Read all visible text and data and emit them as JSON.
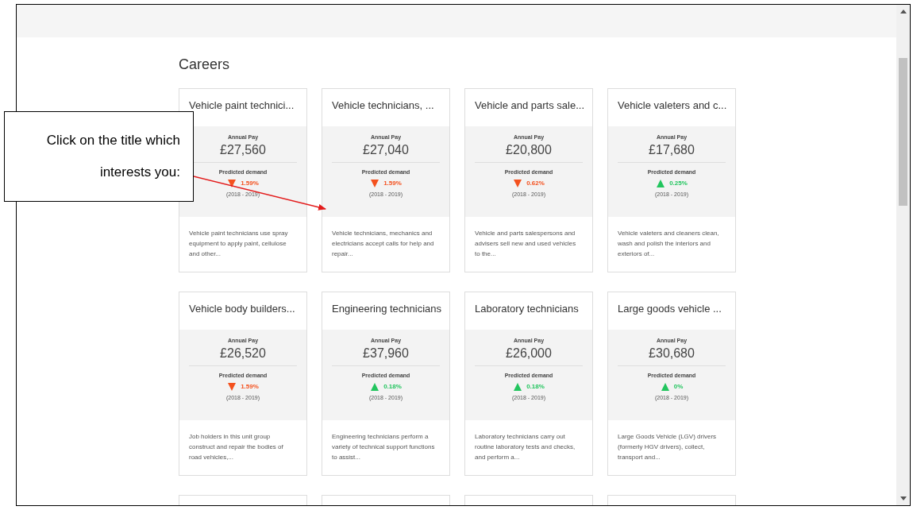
{
  "heading": "Careers",
  "cards": [
    {
      "title": "Vehicle paint technici...",
      "pay_label": "Annual Pay",
      "pay": "£27,560",
      "demand_label": "Predicted demand",
      "kind": "down",
      "change": "1.59%",
      "period": "(2018 - 2019)",
      "summary": "Vehicle paint technicians use spray equipment to apply paint, cellulose and other..."
    },
    {
      "title": "Vehicle technicians, ...",
      "pay_label": "Annual Pay",
      "pay": "£27,040",
      "demand_label": "Predicted demand",
      "kind": "down",
      "change": "1.59%",
      "period": "(2018 - 2019)",
      "summary": "Vehicle technicians, mechanics and electricians accept calls for help and repair..."
    },
    {
      "title": "Vehicle and parts sale...",
      "pay_label": "Annual Pay",
      "pay": "£20,800",
      "demand_label": "Predicted demand",
      "kind": "down",
      "change": "0.62%",
      "period": "(2018 - 2019)",
      "summary": "Vehicle and parts salespersons and advisers sell new and used vehicles to the..."
    },
    {
      "title": "Vehicle valeters and c...",
      "pay_label": "Annual Pay",
      "pay": "£17,680",
      "demand_label": "Predicted demand",
      "kind": "up",
      "change": "0.25%",
      "period": "(2018 - 2019)",
      "summary": "Vehicle valeters and cleaners clean, wash and polish the interiors and exteriors of..."
    },
    {
      "title": "Vehicle body builders...",
      "pay_label": "Annual Pay",
      "pay": "£26,520",
      "demand_label": "Predicted demand",
      "kind": "down",
      "change": "1.59%",
      "period": "(2018 - 2019)",
      "summary": "Job holders in this unit group construct and repair the bodies of road vehicles,..."
    },
    {
      "title": "Engineering technicians",
      "pay_label": "Annual Pay",
      "pay": "£37,960",
      "demand_label": "Predicted demand",
      "kind": "up",
      "change": "0.18%",
      "period": "(2018 - 2019)",
      "summary": "Engineering technicians perform a variety of technical support functions to assist..."
    },
    {
      "title": "Laboratory technicians",
      "pay_label": "Annual Pay",
      "pay": "£26,000",
      "demand_label": "Predicted demand",
      "kind": "up",
      "change": "0.18%",
      "period": "(2018 - 2019)",
      "summary": "Laboratory technicians carry out routine laboratory tests and checks, and perform a..."
    },
    {
      "title": "Large goods vehicle ...",
      "pay_label": "Annual Pay",
      "pay": "£30,680",
      "demand_label": "Predicted demand",
      "kind": "up",
      "change": "0%",
      "period": "(2018 - 2019)",
      "summary": "Large Goods Vehicle (LGV) drivers (formerly HGV drivers), collect, transport and..."
    }
  ],
  "callout": {
    "lines": [
      "Click on the title which",
      "interests you:"
    ]
  }
}
